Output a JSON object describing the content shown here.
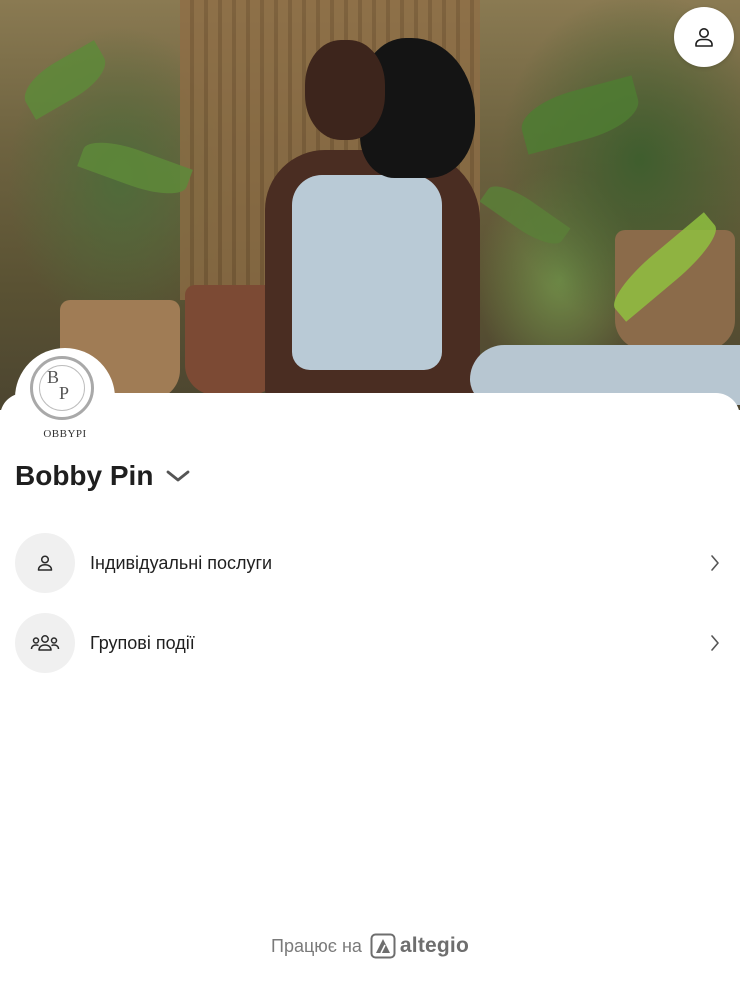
{
  "account": {
    "icon": "user-icon"
  },
  "company": {
    "logo_letter_b": "B",
    "logo_letter_p": "P",
    "logo_wordmark": "OBBYPI",
    "name": "Bobby Pin",
    "dropdown_icon": "chevron-down-icon"
  },
  "menu": {
    "items": [
      {
        "label": "Індивідуальні послуги",
        "icon": "person-icon"
      },
      {
        "label": "Групові події",
        "icon": "group-icon"
      }
    ]
  },
  "footer": {
    "powered_by": "Працює на",
    "brand": "altegio"
  },
  "colors": {
    "background": "#ffffff",
    "text": "#1f1f1f",
    "muted": "#7a7a7a",
    "icon_bg": "#f0f0f0"
  }
}
